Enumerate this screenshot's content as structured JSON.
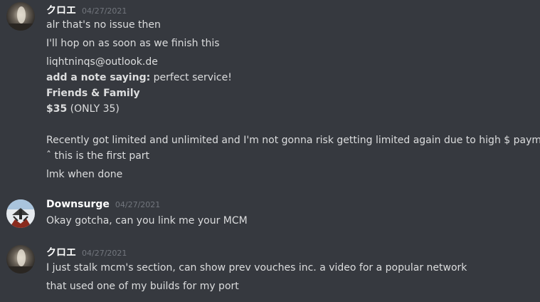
{
  "messages": [
    {
      "author": "クロエ",
      "timestamp": "04/27/2021",
      "avatar_icon": "avatar-chloe-icon",
      "lines": [
        "alr that's no issue then",
        "I'll hop on as soon as we finish this",
        "liqhtninqs@outlook.de",
        {
          "bold": "add a note saying:",
          "text": " perfect service!"
        },
        {
          "bold": "Friends & Family",
          "text": ""
        },
        {
          "bold": "$35",
          "text": " (ONLY 35)"
        },
        "",
        "Recently got limited and unlimited and I'm not gonna risk getting limited again due to high $ payments",
        "ˆ this is the first part",
        "lmk when done"
      ]
    },
    {
      "author": "Downsurge",
      "timestamp": "04/27/2021",
      "avatar_icon": "avatar-downsurge-icon",
      "lines": [
        "Okay gotcha, can you link me your MCM"
      ]
    },
    {
      "author": "クロエ",
      "timestamp": "04/27/2021",
      "avatar_icon": "avatar-chloe-icon",
      "lines": [
        "I just stalk mcm's section, can show prev vouches inc. a video for a popular network",
        "that used one of my builds for my port"
      ]
    }
  ],
  "colors": {
    "background": "#36393f",
    "text": "#dcddde",
    "username": "#ffffff",
    "timestamp": "#72767d"
  }
}
